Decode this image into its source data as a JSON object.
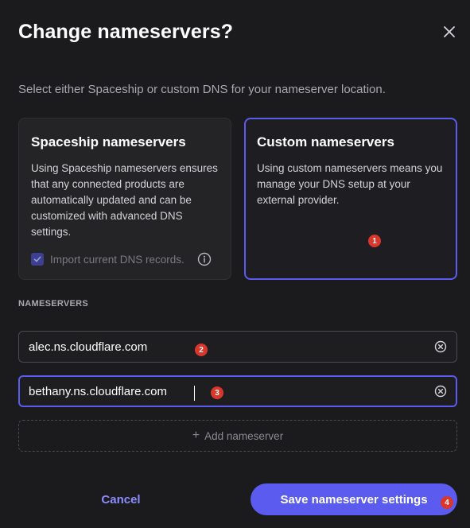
{
  "dialog": {
    "title": "Change nameservers?",
    "subtitle": "Select either Spaceship or custom DNS for your nameserver location."
  },
  "options": {
    "spaceship": {
      "title": "Spaceship nameservers",
      "description": "Using Spaceship nameservers ensures that any connected products are automatically updated and can be customized with advanced DNS settings.",
      "import_label": "Import current DNS records.",
      "import_checked": true,
      "selected": false
    },
    "custom": {
      "title": "Custom nameservers",
      "description": "Using custom nameservers means you manage your DNS setup at your external provider.",
      "selected": true
    }
  },
  "nameservers": {
    "section_label": "NAMESERVERS",
    "fields": [
      {
        "value": "alec.ns.cloudflare.com"
      },
      {
        "value": "bethany.ns.cloudflare.com",
        "focused": true
      }
    ],
    "add_label": "Add nameserver"
  },
  "footer": {
    "cancel_label": "Cancel",
    "save_label": "Save nameserver settings"
  },
  "markers": [
    "1",
    "2",
    "3",
    "4"
  ],
  "colors": {
    "background": "#1b1b1e",
    "accent": "#5b5bef",
    "link": "#8c8cff",
    "marker": "#d9372b"
  },
  "icons": {
    "close": "close-icon",
    "checkbox": "check-icon",
    "info": "info-icon",
    "clear": "clear-circle-icon",
    "add": "plus-icon"
  }
}
